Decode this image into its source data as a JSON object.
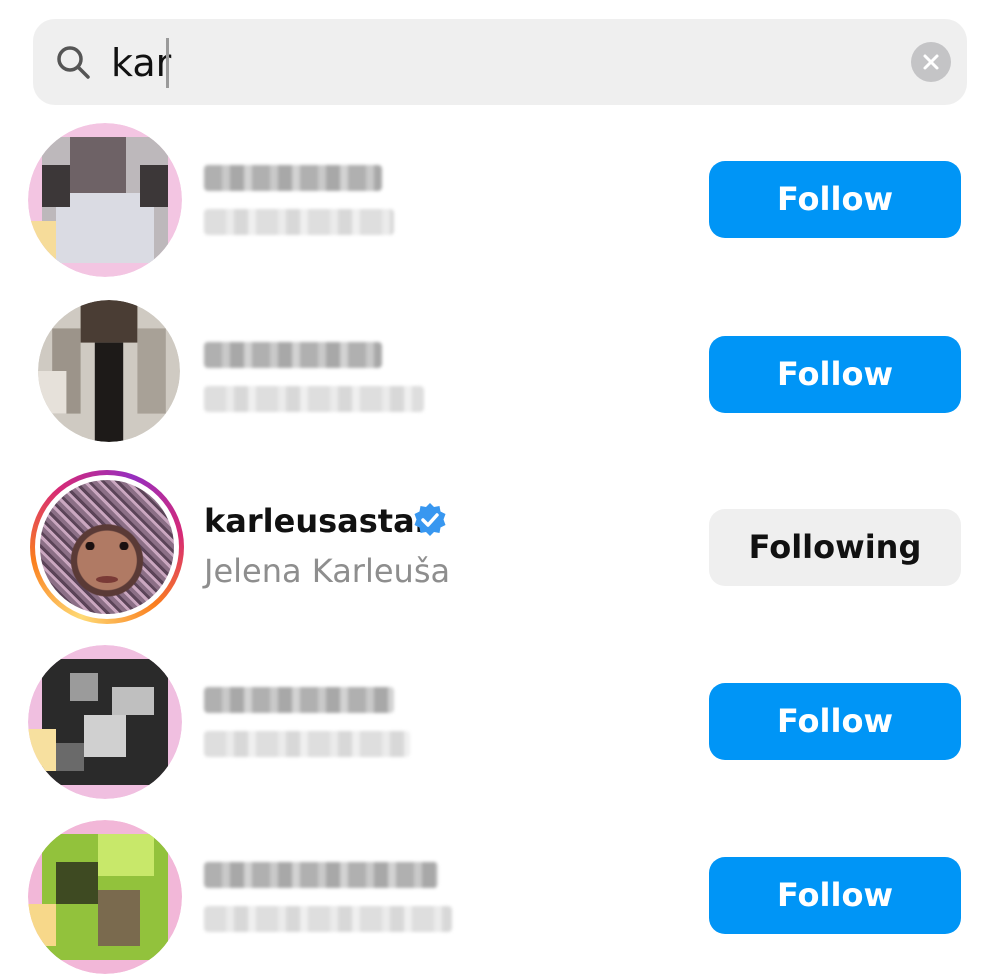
{
  "search": {
    "query": "kar",
    "icon": "search-icon",
    "clear_icon": "clear-icon"
  },
  "results": [
    {
      "kind": "blurred",
      "button_label": "Follow"
    },
    {
      "kind": "blurred",
      "button_label": "Follow"
    },
    {
      "kind": "visible",
      "username": "karleusastar",
      "full_name": "Jelena Karleuša",
      "verified": true,
      "button_label": "Following"
    },
    {
      "kind": "blurred",
      "button_label": "Follow"
    },
    {
      "kind": "blurred",
      "button_label": "Follow"
    }
  ],
  "colors": {
    "follow_button": "#0095f6",
    "following_button": "#efefef",
    "verified_badge": "#3897f0",
    "search_bg": "#efefef"
  }
}
